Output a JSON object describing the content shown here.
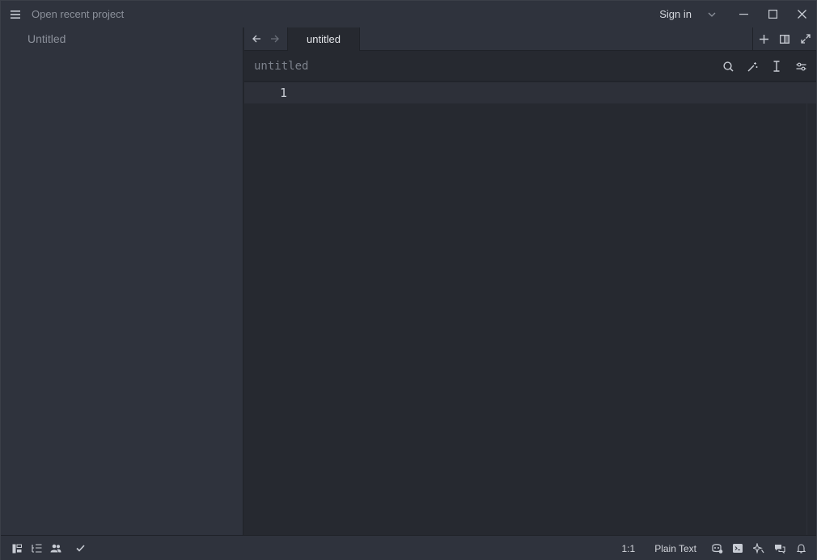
{
  "titlebar": {
    "recent_label": "Open recent project",
    "signin_label": "Sign in"
  },
  "sidebar": {
    "items": [
      {
        "label": "Untitled"
      }
    ]
  },
  "tabs": [
    {
      "label": "untitled",
      "active": true
    }
  ],
  "editor": {
    "path": "untitled",
    "line_numbers": [
      "1"
    ]
  },
  "statusbar": {
    "cursor_position": "1:1",
    "language": "Plain Text"
  },
  "colors": {
    "background": "#262930",
    "panel": "#2f333d",
    "text": "#c8ccd4",
    "muted_text": "#8b909a"
  }
}
